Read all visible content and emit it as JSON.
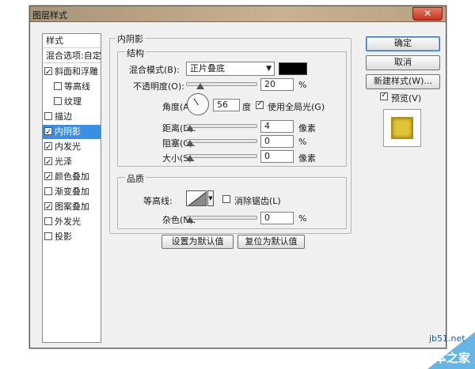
{
  "window": {
    "title": "图层样式",
    "close_glyph": "✕"
  },
  "sidebar": {
    "header": "样式",
    "blend_options": "混合选项:自定",
    "items": [
      {
        "label": "斜面和浮雕",
        "checked": true
      },
      {
        "label": "等高线",
        "checked": false
      },
      {
        "label": "纹理",
        "checked": false
      },
      {
        "label": "描边",
        "checked": false
      },
      {
        "label": "内阴影",
        "checked": true,
        "selected": true
      },
      {
        "label": "内发光",
        "checked": true
      },
      {
        "label": "光泽",
        "checked": true
      },
      {
        "label": "颜色叠加",
        "checked": true
      },
      {
        "label": "渐变叠加",
        "checked": false
      },
      {
        "label": "图案叠加",
        "checked": true
      },
      {
        "label": "外发光",
        "checked": false
      },
      {
        "label": "投影",
        "checked": false
      }
    ]
  },
  "inner_shadow": {
    "title": "内阴影",
    "structure": {
      "title": "结构",
      "blend_mode_label": "混合模式(B):",
      "blend_mode_value": "正片叠底",
      "blend_color": "#000000",
      "opacity_label": "不透明度(O):",
      "opacity_value": "20",
      "opacity_unit": "%",
      "angle_label": "角度(A):",
      "angle_value": "56",
      "angle_unit": "度",
      "global_light_label": "使用全局光(G)",
      "global_light_checked": true,
      "distance_label": "距离(D):",
      "distance_value": "4",
      "distance_unit": "像素",
      "choke_label": "阻塞(C):",
      "choke_value": "0",
      "choke_unit": "%",
      "size_label": "大小(S):",
      "size_value": "0",
      "size_unit": "像素"
    },
    "quality": {
      "title": "品质",
      "contour_label": "等高线:",
      "antialias_label": "消除锯齿(L)",
      "antialias_checked": false,
      "noise_label": "杂色(N):",
      "noise_value": "0",
      "noise_unit": "%"
    },
    "set_default_label": "设置为默认值",
    "reset_default_label": "复位为默认值"
  },
  "actions": {
    "ok_label": "确定",
    "cancel_label": "取消",
    "new_style_label": "新建样式(W)...",
    "preview_label": "预览(V)",
    "preview_checked": true,
    "preview_color": "#e0c53a"
  },
  "watermark": {
    "site": "jb51.net",
    "name": "脚本之家"
  }
}
